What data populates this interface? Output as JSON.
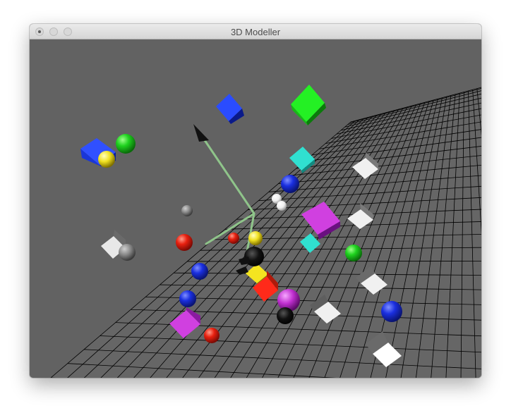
{
  "window": {
    "title": "3D Modeller"
  },
  "colors": {
    "titlebar": "#e4e4e4",
    "scene_background": "#626262",
    "grid_plane": "#ffffff",
    "grid_lines": "#000000",
    "axis": "#8fc48a"
  }
}
